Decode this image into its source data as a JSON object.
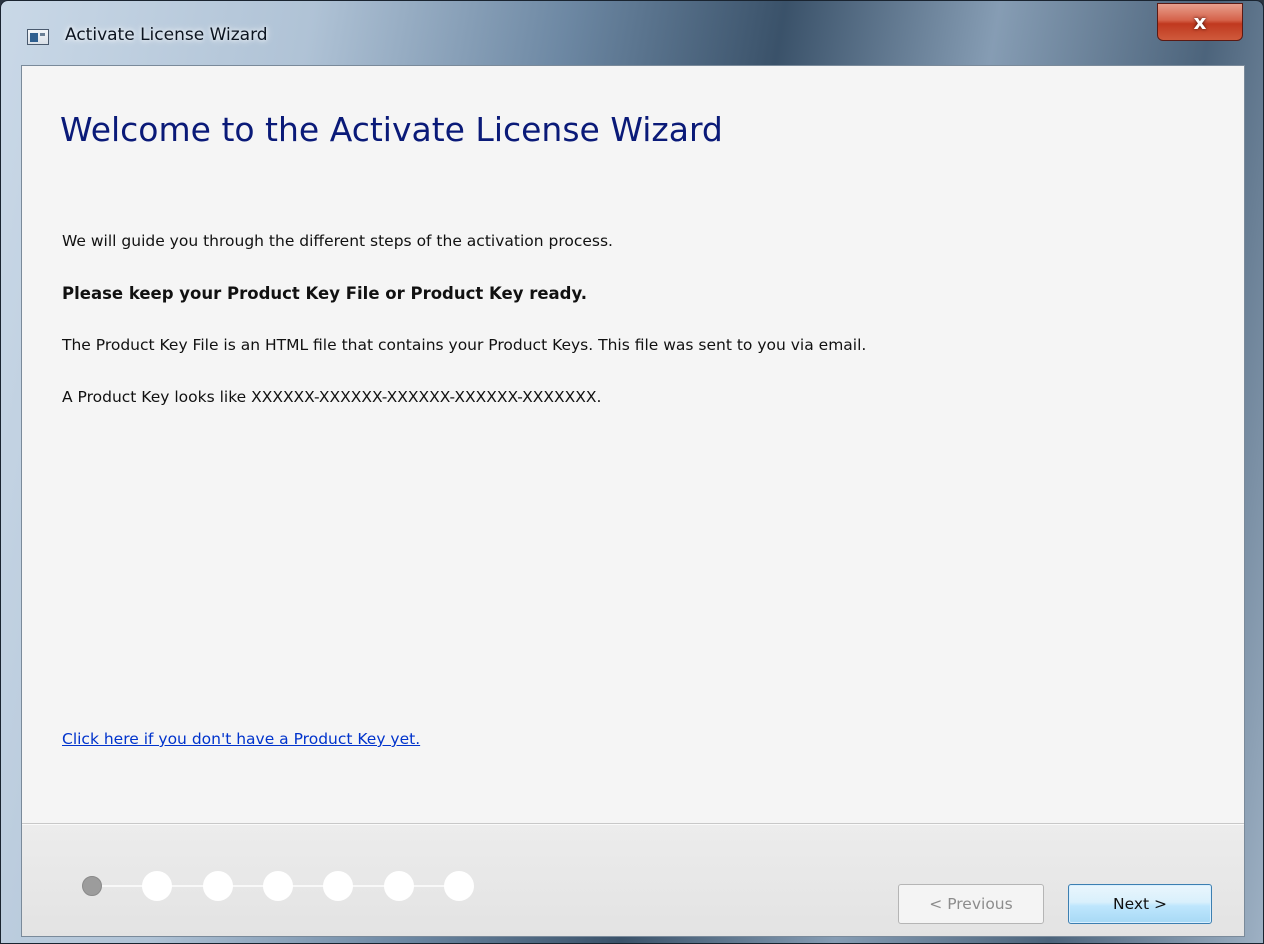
{
  "window": {
    "title": "Activate License Wizard",
    "close_label": "x"
  },
  "content": {
    "heading": "Welcome to the Activate License Wizard",
    "paragraphs": [
      "We will guide you through the different steps of the activation process.",
      "Please keep your Product Key File or Product Key ready.",
      "The Product Key File is an HTML file that contains your Product Keys. This file was sent to you via email.",
      "A Product Key looks like XXXXXX-XXXXXX-XXXXXX-XXXXXX-XXXXXXX."
    ],
    "help_link": "Click here if you don't have a Product Key yet."
  },
  "footer": {
    "steps_total": 7,
    "current_step": 1,
    "previous_label": "< Previous",
    "next_label": "Next >"
  },
  "colors": {
    "heading": "#0a1a78",
    "link": "#0033cc",
    "active_step": "#9c9c9c",
    "close_button": "#c0391f"
  }
}
